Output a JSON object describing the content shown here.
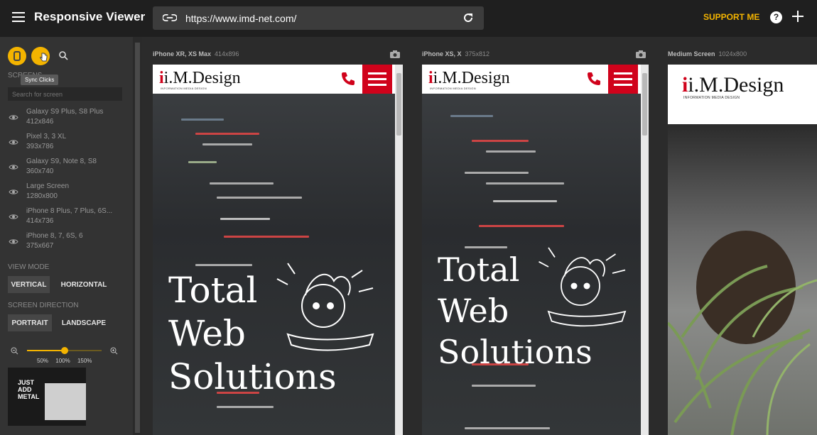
{
  "header": {
    "app_title": "Responsive Viewer",
    "url": "https://www.imd-net.com/",
    "support_label": "SUPPORT ME",
    "help_glyph": "?"
  },
  "sidebar": {
    "tooltip": "Sync Clicks",
    "screens_label": "SCREENS",
    "search_placeholder": "Search for screen",
    "screens": [
      {
        "name": "Galaxy S9 Plus, S8 Plus",
        "dims": "412x846"
      },
      {
        "name": "Pixel 3, 3 XL",
        "dims": "393x786"
      },
      {
        "name": "Galaxy S9, Note 8, S8",
        "dims": "360x740"
      },
      {
        "name": "Large Screen",
        "dims": "1280x800"
      },
      {
        "name": "iPhone 8 Plus, 7 Plus, 6S...",
        "dims": "414x736"
      },
      {
        "name": "iPhone 8, 7, 6S, 6",
        "dims": "375x667"
      }
    ],
    "view_mode_label": "VIEW MODE",
    "view_mode_options": [
      "VERTICAL",
      "HORIZONTAL"
    ],
    "view_mode_selected": "VERTICAL",
    "direction_label": "SCREEN DIRECTION",
    "direction_options": [
      "PORTRAIT",
      "LANDSCAPE"
    ],
    "direction_selected": "PORTRAIT",
    "zoom": {
      "labels": [
        "50%",
        "100%",
        "150%"
      ],
      "value": 0.5
    },
    "thumbnail_text": "JUST ADD METAL"
  },
  "devices": [
    {
      "name": "iPhone XR, XS Max",
      "dims": "414x896"
    },
    {
      "name": "iPhone XS, X",
      "dims": "375x812"
    },
    {
      "name": "Medium Screen",
      "dims": "1024x800"
    }
  ],
  "site": {
    "logo_main": "i.M.Design",
    "logo_sub": "INFORMATION MEDIA DESIGN",
    "hero_lines": [
      "Total",
      "Web",
      "Solutions"
    ]
  },
  "colors": {
    "accent": "#f4b400",
    "brand_red": "#d0021b",
    "topbar": "#1f1f1f",
    "sidebar": "#333333"
  }
}
